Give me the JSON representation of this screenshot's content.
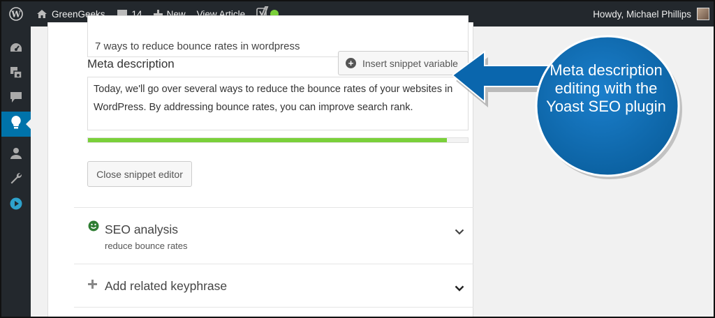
{
  "adminbar": {
    "site_name": "GreenGeeks",
    "comments_count": "14",
    "new_label": "New",
    "view_label": "View Article",
    "howdy": "Howdy, Michael Phillips"
  },
  "editor": {
    "title_value": "7 ways to reduce bounce rates in wordpress",
    "meta_label": "Meta description",
    "insert_snippet_label": "Insert snippet variable",
    "meta_description": "Today, we'll go over several ways to reduce the bounce rates of your websites in WordPress. By addressing bounce rates, you can improve search rank.",
    "progress_fraction": 0.945,
    "close_snippet_label": "Close snippet editor",
    "seo_analysis_title": "SEO analysis",
    "seo_analysis_sub": "reduce bounce rates",
    "related_keyphrase_title": "Add related keyphrase"
  },
  "callout": {
    "text": "Meta description editing with the Yoast SEO plugin"
  },
  "colors": {
    "adminbar": "#23282d",
    "active_menu": "#0073aa",
    "progress_green": "#7ad03a",
    "callout_blue": "#0a6ab3"
  }
}
